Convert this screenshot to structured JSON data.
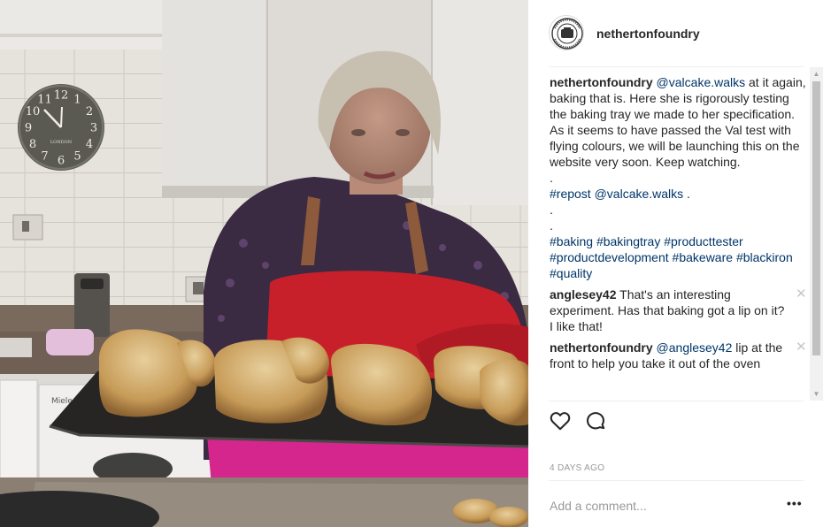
{
  "header": {
    "username": "nethertonfoundry",
    "avatar_icon": "foundry-logo-icon"
  },
  "media": {
    "clock": {
      "numerals": [
        "12",
        "1",
        "2",
        "3",
        "4",
        "5",
        "6",
        "7",
        "8",
        "9",
        "10",
        "11"
      ],
      "brand": "LONDON"
    },
    "oven_brand": "Miele"
  },
  "caption": {
    "username": "nethertonfoundry",
    "mention": "@valcake.walks",
    "text": " at it again, baking that is. Here she is rigorously testing the baking tray we made to her specification. As it seems to have passed the Val test with flying colours, we will be launching this on the website very soon. Keep watching.",
    "dot1": ".",
    "repost_tag": "#repost",
    "repost_mention": "@valcake.walks",
    "repost_tail": " .",
    "dot2": ".",
    "dot3": ".",
    "tags": [
      "#baking",
      "#bakingtray",
      "#producttester",
      "#productdevelopment",
      "#bakeware",
      "#blackiron",
      "#quality"
    ]
  },
  "comments": [
    {
      "username": "anglesey42",
      "text": "That's an interesting experiment. Has that baking got a lip on it? I like that!",
      "close_label": "✕"
    },
    {
      "username": "nethertonfoundry",
      "mention": "@anglesey42",
      "text": " lip at the front to help you take it out of the oven",
      "close_label": "✕"
    }
  ],
  "actions": {
    "like_icon": "heart-icon",
    "comment_icon": "comment-bubble-icon"
  },
  "timestamp": "4 DAYS AGO",
  "add_comment": {
    "placeholder": "Add a comment...",
    "more_label": "•••"
  },
  "scrollbar": {
    "up_arrow": "▲",
    "down_arrow": "▼"
  },
  "colors": {
    "link": "#003569",
    "muted": "#999999",
    "text": "#262626",
    "oven_glove": "#c8202a",
    "apron_pink": "#d4268c"
  }
}
